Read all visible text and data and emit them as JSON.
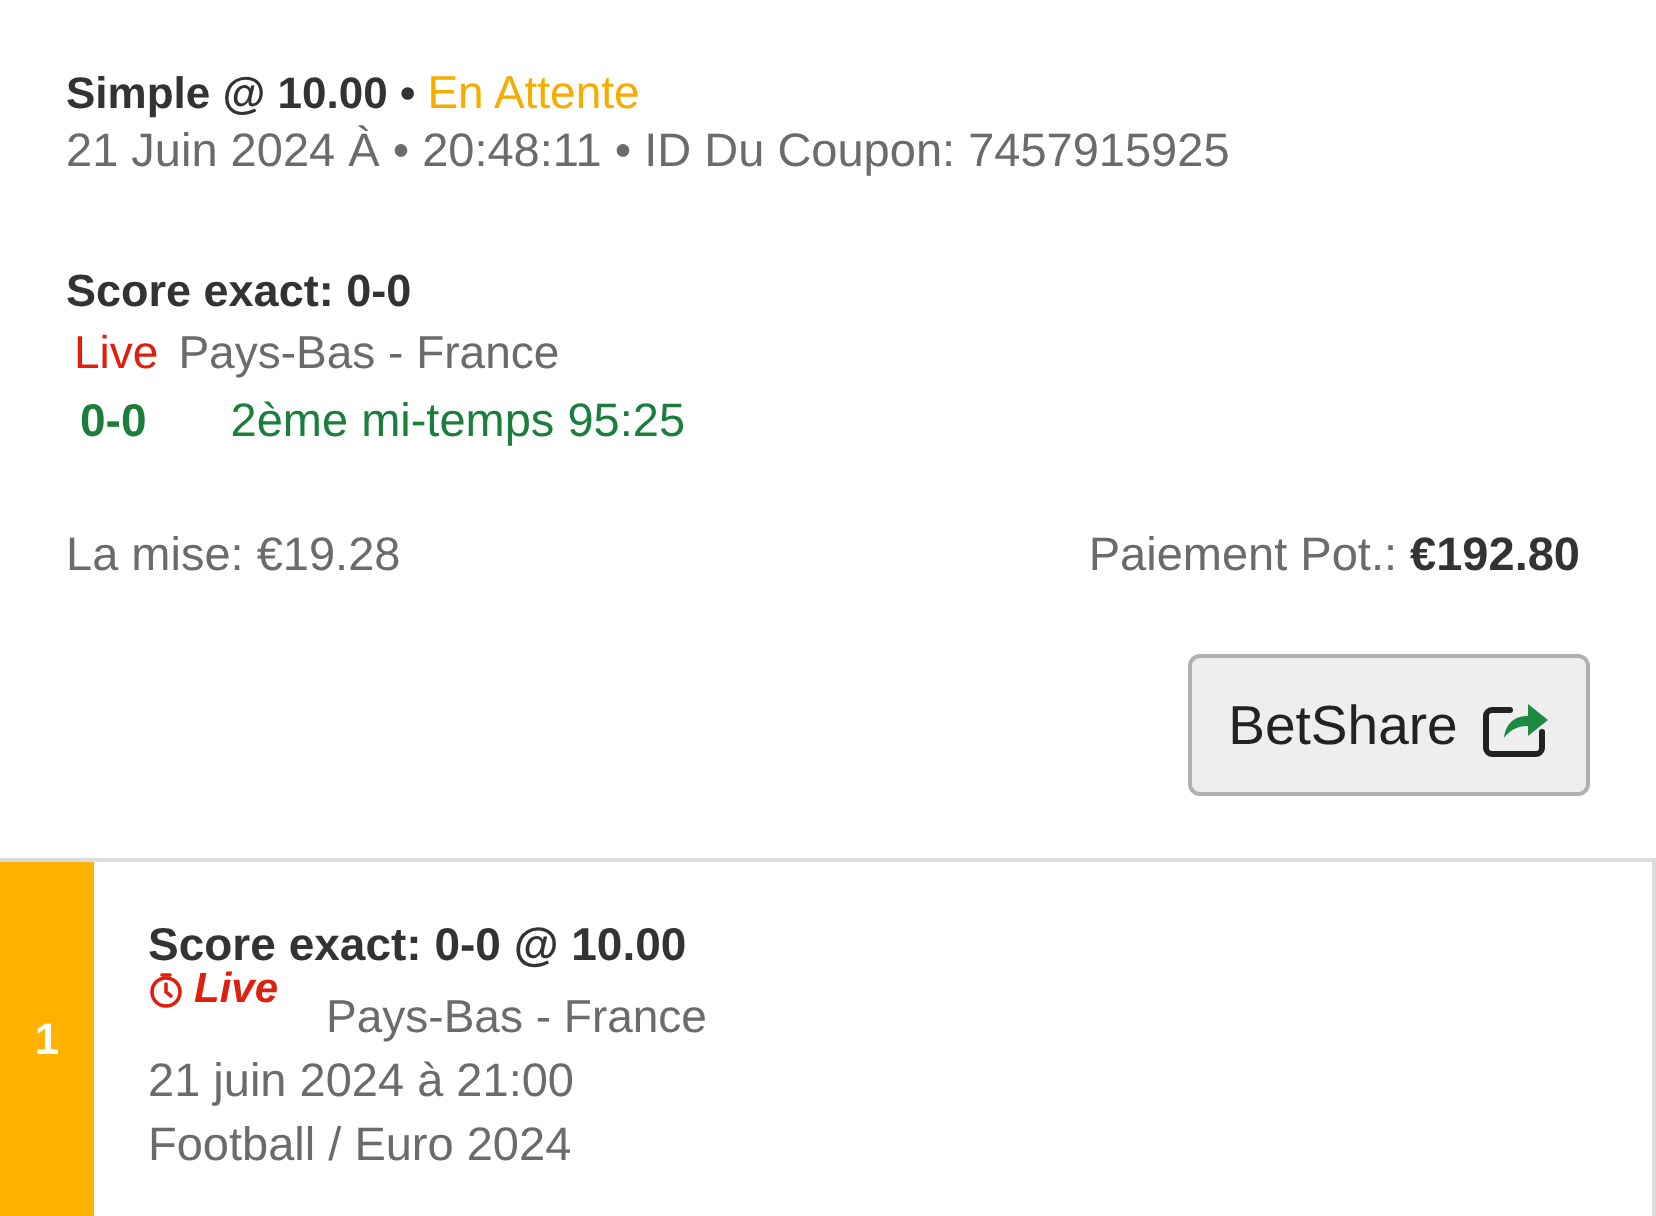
{
  "bet": {
    "title": "Simple @ 10.00 •",
    "status": {
      "text": "En Attente",
      "kind": "pending"
    },
    "meta": "21 Juin 2024 À • 20:48:11 • ID Du Coupon: 7457915925"
  },
  "selection": {
    "market": "Score exact: 0-0",
    "live_label": "Live",
    "match": "Pays-Bas - France",
    "score": "0-0",
    "period": "2ème mi-temps 95:25"
  },
  "stake": "La mise: €19.28",
  "payout": "Paiement Pot.: **€192.80**",
  "share_button": {
    "label": "BetShare"
  },
  "legs": [
    {
      "number": "1",
      "title": "Score exact: 0-0 @ 10.00",
      "live_label": "Live",
      "match": "Pays-Bas - France",
      "date": "21 juin 2024 à 21:00",
      "competition": "Football / Euro 2024"
    }
  ]
}
